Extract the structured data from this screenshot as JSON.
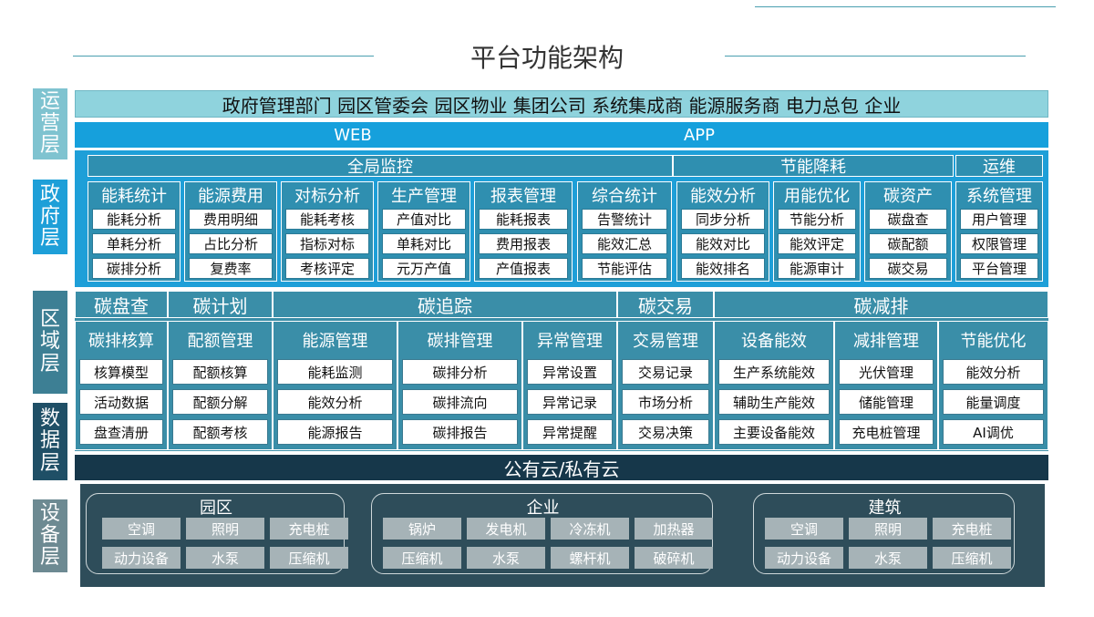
{
  "title": "平台功能架构",
  "layers": {
    "ops": [
      "运",
      "营",
      "层"
    ],
    "gov": [
      "政",
      "府",
      "层"
    ],
    "region": [
      "区",
      "域",
      "层"
    ],
    "data": [
      "数",
      "据",
      "层"
    ],
    "device": [
      "设",
      "备",
      "层"
    ]
  },
  "stakeholders": "政府管理部门  园区管委会  园区物业  集团公司  系统集成商  能源服务商  电力总包  企业",
  "web": "WEB",
  "app": "APP",
  "gov_groups": [
    {
      "label": "全局监控"
    },
    {
      "label": "节能降耗"
    },
    {
      "label": "运维"
    }
  ],
  "gov_modules": [
    {
      "title": "能耗统计",
      "items": [
        "能耗分析",
        "单耗分析",
        "碳排分析"
      ]
    },
    {
      "title": "能源费用",
      "items": [
        "费用明细",
        "占比分析",
        "复费率"
      ]
    },
    {
      "title": "对标分析",
      "items": [
        "能耗考核",
        "指标对标",
        "考核评定"
      ]
    },
    {
      "title": "生产管理",
      "items": [
        "产值对比",
        "单耗对比",
        "元万产值"
      ]
    },
    {
      "title": "报表管理",
      "items": [
        "能耗报表",
        "费用报表",
        "产值报表"
      ]
    },
    {
      "title": "综合统计",
      "items": [
        "告警统计",
        "能效汇总",
        "节能评估"
      ]
    },
    {
      "title": "能效分析",
      "items": [
        "同步分析",
        "能效对比",
        "能效排名"
      ]
    },
    {
      "title": "用能优化",
      "items": [
        "节能分析",
        "能效评定",
        "能源审计"
      ]
    },
    {
      "title": "碳资产",
      "items": [
        "碳盘查",
        "碳配额",
        "碳交易"
      ]
    },
    {
      "title": "系统管理",
      "items": [
        "用户管理",
        "权限管理",
        "平台管理"
      ]
    }
  ],
  "region_groups": [
    {
      "label": "碳盘查"
    },
    {
      "label": "碳计划"
    },
    {
      "label": "碳追踪"
    },
    {
      "label": "碳交易"
    },
    {
      "label": "碳减排"
    }
  ],
  "region_modules": [
    {
      "title": "碳排核算",
      "items": [
        "核算模型",
        "活动数据",
        "盘查清册"
      ]
    },
    {
      "title": "配额管理",
      "items": [
        "配额核算",
        "配额分解",
        "配额考核"
      ]
    },
    {
      "title": "能源管理",
      "items": [
        "能耗监测",
        "能效分析",
        "能源报告"
      ]
    },
    {
      "title": "碳排管理",
      "items": [
        "碳排分析",
        "碳排流向",
        "碳排报告"
      ]
    },
    {
      "title": "异常管理",
      "items": [
        "异常设置",
        "异常记录",
        "异常提醒"
      ]
    },
    {
      "title": "交易管理",
      "items": [
        "交易记录",
        "市场分析",
        "交易决策"
      ]
    },
    {
      "title": "设备能效",
      "items": [
        "生产系统能效",
        "辅助生产能效",
        "主要设备能效"
      ]
    },
    {
      "title": "减排管理",
      "items": [
        "光伏管理",
        "储能管理",
        "充电桩管理"
      ]
    },
    {
      "title": "节能优化",
      "items": [
        "能效分析",
        "能量调度",
        "AI调优"
      ]
    }
  ],
  "cloud": "公有云/私有云",
  "device_groups": [
    {
      "title": "园区",
      "items": [
        "空调",
        "照明",
        "充电桩",
        "动力设备",
        "水泵",
        "压缩机"
      ]
    },
    {
      "title": "企业",
      "items": [
        "锅炉",
        "发电机",
        "冷冻机",
        "加热器",
        "压缩机",
        "水泵",
        "螺杆机",
        "破碎机"
      ]
    },
    {
      "title": "建筑",
      "items": [
        "空调",
        "照明",
        "充电桩",
        "动力设备",
        "水泵",
        "压缩机"
      ]
    }
  ],
  "colors": {
    "ops_label": "#7fc3d0",
    "gov_label": "#1e9fd8",
    "region_label": "#3d7f94",
    "data_label": "#1f4f66",
    "device_label": "#6d8a92",
    "stakeholder_bar": "#8fd3dd",
    "web_bar": "#16a0dc",
    "gov_bg": "#1e9fd8",
    "region_bg": "#3a8ea8",
    "cloud_bar": "#16374a",
    "device_bg": "#2e4d5a"
  }
}
